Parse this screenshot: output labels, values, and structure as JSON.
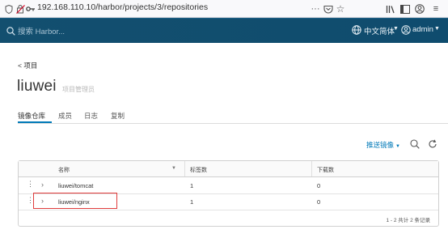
{
  "browser": {
    "url": "192.168.110.10/harbor/projects/3/repositories"
  },
  "header": {
    "search_placeholder": "搜索 Harbor...",
    "language": "中文简体",
    "user": "admin"
  },
  "breadcrumb": {
    "back_label": "< 项目"
  },
  "project": {
    "name": "liuwei",
    "role": "项目管理员"
  },
  "tabs": [
    {
      "label": "镜像仓库",
      "active": true
    },
    {
      "label": "成员",
      "active": false
    },
    {
      "label": "日志",
      "active": false
    },
    {
      "label": "复制",
      "active": false
    }
  ],
  "toolbar": {
    "push_label": "推送镜像"
  },
  "table": {
    "columns": [
      "名称",
      "标签数",
      "下载数"
    ],
    "rows": [
      {
        "name": "liuwei/tomcat",
        "tags": "1",
        "pulls": "0"
      },
      {
        "name": "liuwei/nginx",
        "tags": "1",
        "pulls": "0"
      }
    ],
    "footer": "1 - 2 共计 2 条记录"
  },
  "colors": {
    "header_bg": "#0f4c6e",
    "accent": "#0079b8",
    "highlight": "#e03c3c"
  },
  "icons": [
    "shield-icon",
    "tracking-icon",
    "key-icon",
    "more-icon",
    "pocket-icon",
    "star-icon",
    "library-icon",
    "reader-icon",
    "account-icon",
    "menu-icon",
    "search-icon",
    "globe-icon",
    "user-icon",
    "refresh-icon"
  ]
}
